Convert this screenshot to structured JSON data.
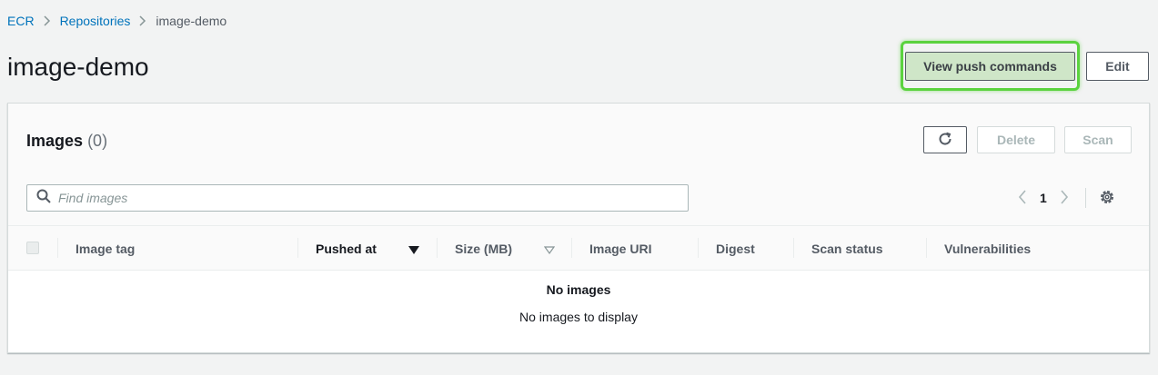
{
  "breadcrumb": {
    "items": [
      "ECR",
      "Repositories"
    ],
    "current": "image-demo"
  },
  "page": {
    "title": "image-demo"
  },
  "actions": {
    "push_label": "View push commands",
    "edit_label": "Edit"
  },
  "panel": {
    "title": "Images",
    "count": "(0)",
    "delete_label": "Delete",
    "scan_label": "Scan",
    "search_placeholder": "Find images",
    "page_number": "1"
  },
  "table": {
    "columns": [
      "Image tag",
      "Pushed at",
      "Size (MB)",
      "Image URI",
      "Digest",
      "Scan status",
      "Vulnerabilities"
    ],
    "empty_title": "No images",
    "empty_message": "No images to display"
  },
  "colors": {
    "link": "#0073bb",
    "highlight": "#5bd23f",
    "push_fill": "#cfe6c8"
  },
  "icons": [
    "chevron-right-icon",
    "refresh-icon",
    "search-icon",
    "chevron-left-icon",
    "gear-icon",
    "sort-desc-icon",
    "sort-icon"
  ]
}
